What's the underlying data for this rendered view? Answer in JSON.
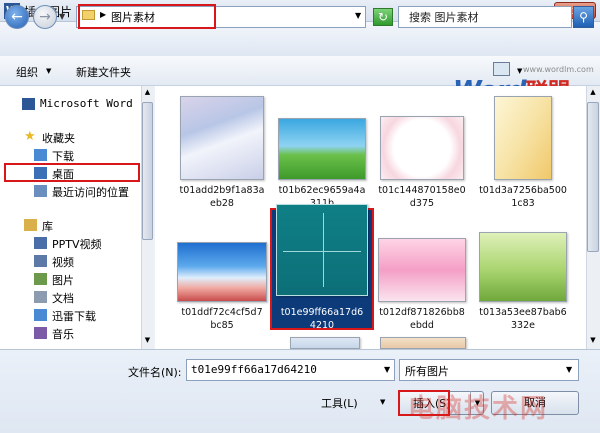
{
  "window": {
    "title": "插入图片",
    "app_icon": "W",
    "close_label": "x"
  },
  "address": {
    "path": "图片素材",
    "search_placeholder": "搜索 图片素材"
  },
  "toolbar": {
    "organize": "组织",
    "new_folder": "新建文件夹"
  },
  "watermark": {
    "url": "www.wordlm.com",
    "logo_latin": "Word",
    "logo_cn": "联盟",
    "bottom_text": "电脑技术网"
  },
  "nav": {
    "items": [
      {
        "label": "Microsoft Word",
        "icon": "word-doc-icon"
      },
      {
        "label": "收藏夹",
        "icon": "star-icon"
      },
      {
        "label": "下载",
        "icon": "download-folder-icon"
      },
      {
        "label": "桌面",
        "icon": "desktop-icon"
      },
      {
        "label": "最近访问的位置",
        "icon": "recent-places-icon"
      },
      {
        "label": "库",
        "icon": "library-icon"
      },
      {
        "label": "PPTV视频",
        "icon": "video-folder-icon"
      },
      {
        "label": "视频",
        "icon": "video-library-icon"
      },
      {
        "label": "图片",
        "icon": "pictures-library-icon"
      },
      {
        "label": "文档",
        "icon": "documents-library-icon"
      },
      {
        "label": "迅雷下载",
        "icon": "download-folder-icon"
      },
      {
        "label": "音乐",
        "icon": "music-library-icon"
      }
    ]
  },
  "files": [
    {
      "line1": "t01add2b9f1a83a",
      "line2": "eb28"
    },
    {
      "line1": "t01b62ec9659a4a",
      "line2": "311b"
    },
    {
      "line1": "t01c144870158e0",
      "line2": "d375"
    },
    {
      "line1": "t01d3a7256ba500",
      "line2": "1c83"
    },
    {
      "line1": "t01ddf72c4cf5d7",
      "line2": "bc85"
    },
    {
      "line1": "t01e99ff66a17d6",
      "line2": "4210"
    },
    {
      "line1": "t012df871826bb8",
      "line2": "ebdd"
    },
    {
      "line1": "t013a53ee87bab6",
      "line2": "332e"
    }
  ],
  "footer": {
    "filename_label": "文件名(N):",
    "filename_value": "t01e99ff66a17d64210",
    "filter_value": "所有图片",
    "tools_label": "工具(L)",
    "insert_label": "插入(S)",
    "cancel_label": "取消"
  }
}
